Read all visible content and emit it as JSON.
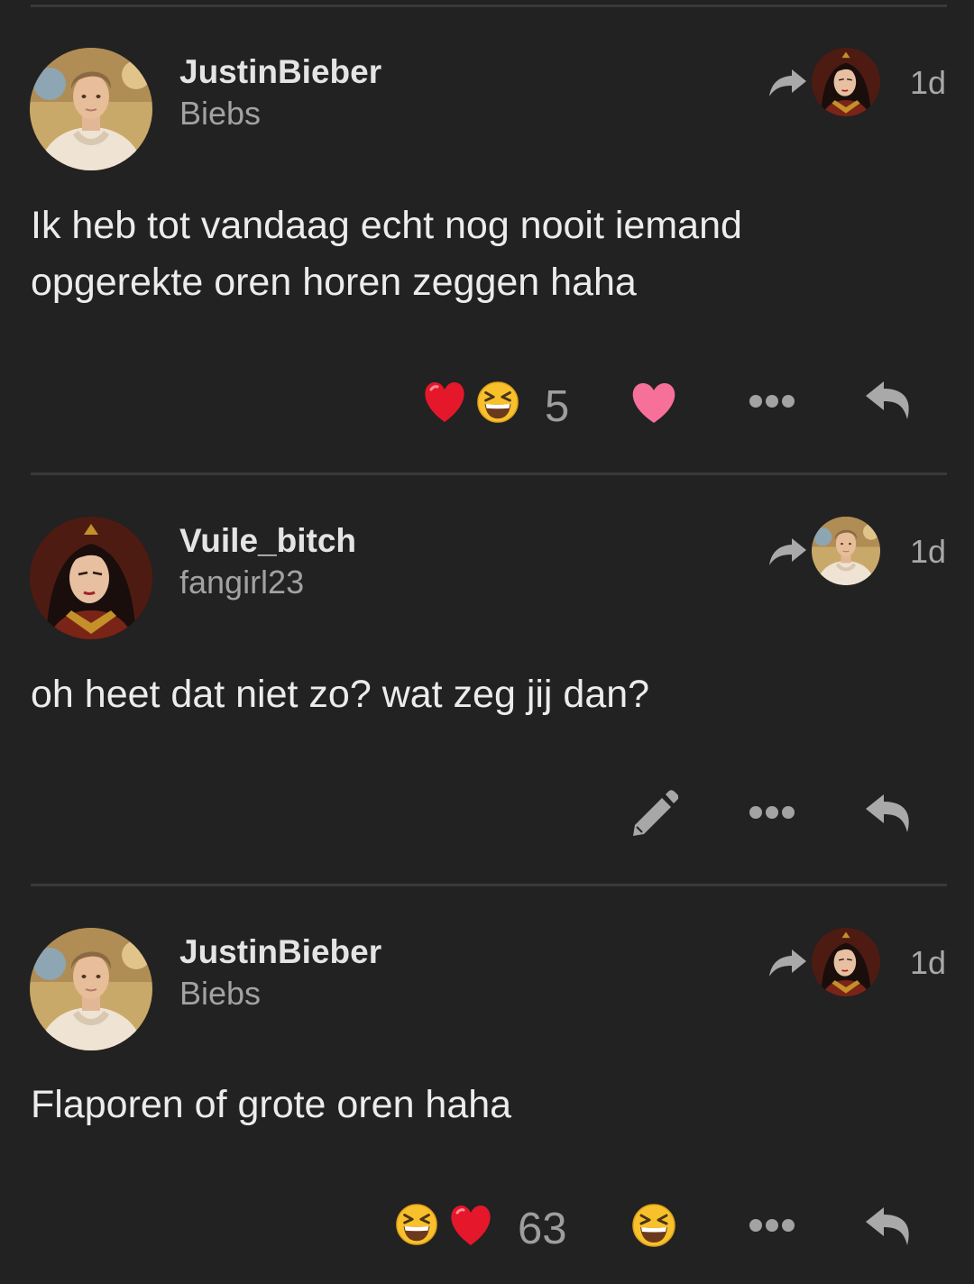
{
  "posts": [
    {
      "username": "JustinBieber",
      "handle": "Biebs",
      "time": "1d",
      "text": "Ik heb tot vandaag echt nog nooit iemand opgerekte oren horen zeggen haha",
      "reaction_count": "5",
      "reactions": [
        "red-heart",
        "laughing-face"
      ],
      "own_reaction": "pink-heart"
    },
    {
      "username": "Vuile_bitch",
      "handle": "fangirl23",
      "time": "1d",
      "text": "oh heet dat niet zo? wat zeg jij dan?"
    },
    {
      "username": "JustinBieber",
      "handle": "Biebs",
      "time": "1d",
      "text": "Flaporen of grote oren haha",
      "reaction_count": "63",
      "reactions": [
        "laughing-face",
        "red-heart"
      ],
      "own_reaction": "laughing-face"
    }
  ],
  "colors": {
    "background": "#222222",
    "divider": "#393939",
    "text": "#ececec",
    "muted": "#a2a2a2",
    "like_pink": "#f7709a"
  }
}
